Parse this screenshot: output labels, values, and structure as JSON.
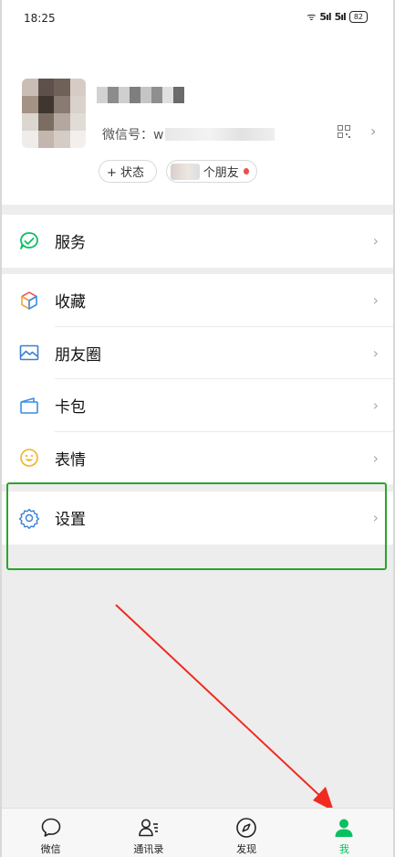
{
  "status_bar": {
    "time": "18:25",
    "signal": "ᯤ",
    "sig1": "5ıl",
    "sig2": "5ıl",
    "battery": "82"
  },
  "profile": {
    "wechat_id_prefix": "微信号：w",
    "status_pill": "+ 状态",
    "friends_pill_suffix": "个朋友"
  },
  "menu": {
    "services": {
      "label": "服务"
    },
    "favorites": {
      "label": "收藏"
    },
    "moments": {
      "label": "朋友圈"
    },
    "cards": {
      "label": "卡包"
    },
    "stickers": {
      "label": "表情"
    },
    "settings": {
      "label": "设置"
    }
  },
  "chevron": "›",
  "nav": {
    "tabs": [
      {
        "label": "微信",
        "icon": "chat-bubble-icon"
      },
      {
        "label": "通讯录",
        "icon": "contacts-icon"
      },
      {
        "label": "发现",
        "icon": "compass-icon"
      },
      {
        "label": "我",
        "icon": "person-icon"
      }
    ],
    "active_index": 3
  },
  "colors": {
    "accent": "#07c160",
    "highlight_border": "#2aa52a",
    "annotation_arrow": "#f02a20",
    "badge": "#f04b48"
  }
}
